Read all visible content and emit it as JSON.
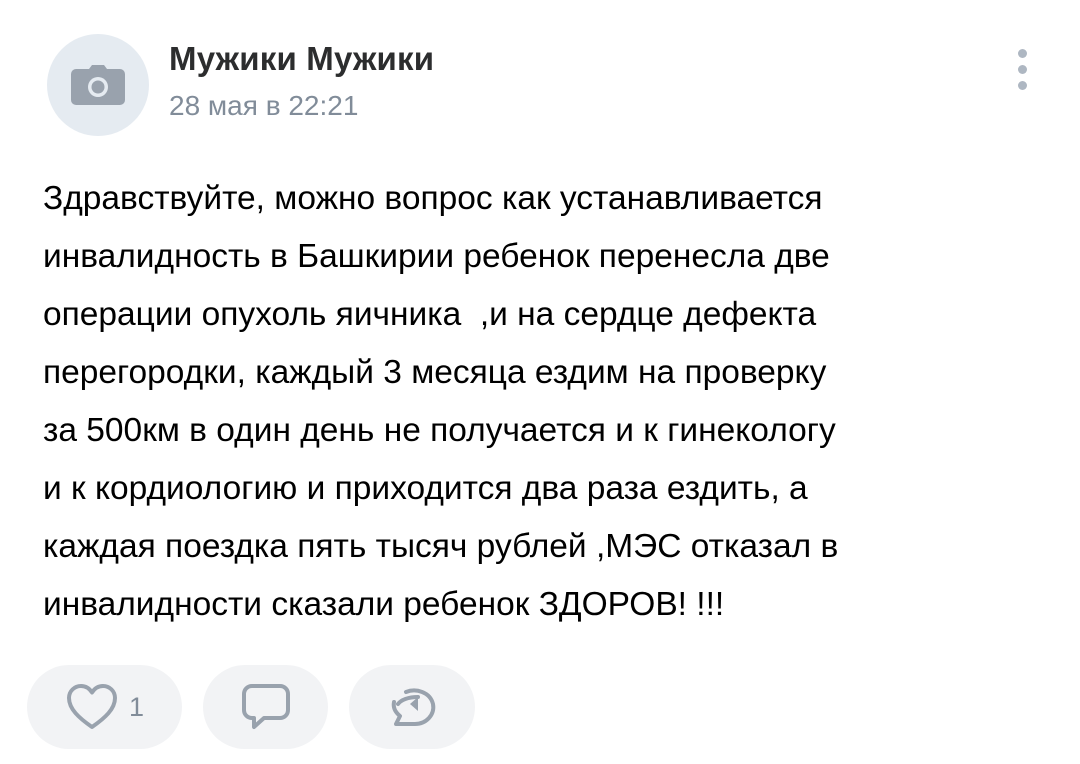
{
  "post": {
    "author": "Мужики Мужики",
    "date": "28 мая в 22:21",
    "avatar_icon": "camera-icon",
    "menu_icon": "more-vertical-icon",
    "text_lines": [
      "Здравствуйте, можно вопрос как устанавливается",
      "инвалидность в Башкирии ребенок перенесла две",
      "операции опухоль яичника  ,и на сердце дефекта",
      "перегородки, каждый 3 месяца ездим на проверку",
      "за 500км в один день не получается и к гинекологу",
      "и к кордиологию и приходится два раза ездить, а",
      "каждая поездка пять тысяч рублей ,МЭС отказал в",
      "инвалидности сказали ребенок ЗДОРОВ! !!!"
    ]
  },
  "actions": {
    "like": {
      "icon": "heart-icon",
      "count": "1"
    },
    "comment": {
      "icon": "comment-icon"
    },
    "share": {
      "icon": "share-icon"
    }
  },
  "colors": {
    "icon": "#99a2ad",
    "secondary_text": "#818c99",
    "button_bg": "#f2f3f5",
    "avatar_bg": "#e5ebf1"
  }
}
